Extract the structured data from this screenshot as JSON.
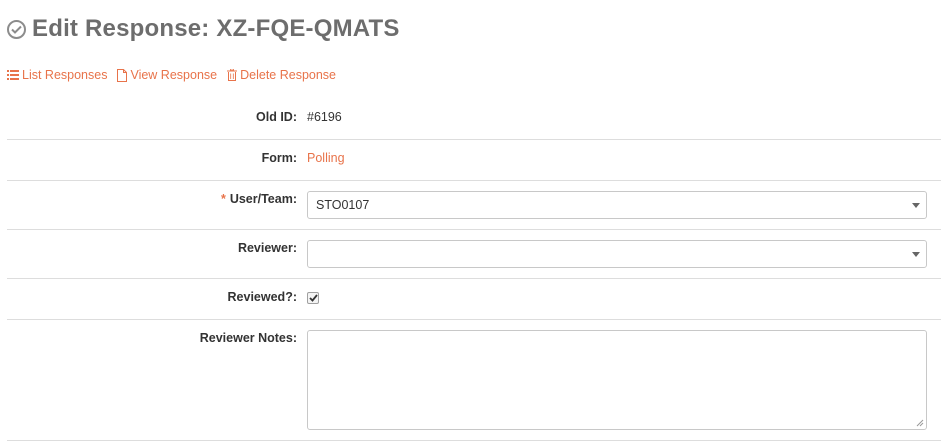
{
  "header": {
    "title": "Edit Response: XZ-FQE-QMATS",
    "icon": "check-circle-icon"
  },
  "actions": [
    {
      "label": "List Responses",
      "icon": "list-icon"
    },
    {
      "label": "View Response",
      "icon": "file-icon"
    },
    {
      "label": "Delete Response",
      "icon": "trash-icon"
    }
  ],
  "form": {
    "old_id": {
      "label": "Old ID:",
      "value": "#6196"
    },
    "form_name": {
      "label": "Form:",
      "value": "Polling"
    },
    "user_team": {
      "label": "User/Team:",
      "required_marker": "*",
      "value": "STO0107"
    },
    "reviewer": {
      "label": "Reviewer:",
      "value": ""
    },
    "reviewed": {
      "label": "Reviewed?:",
      "checked": true
    },
    "reviewer_notes": {
      "label": "Reviewer Notes:",
      "value": ""
    }
  },
  "colors": {
    "accent": "#e8734a",
    "title": "#6d6d6d",
    "divider": "#dddddd"
  }
}
